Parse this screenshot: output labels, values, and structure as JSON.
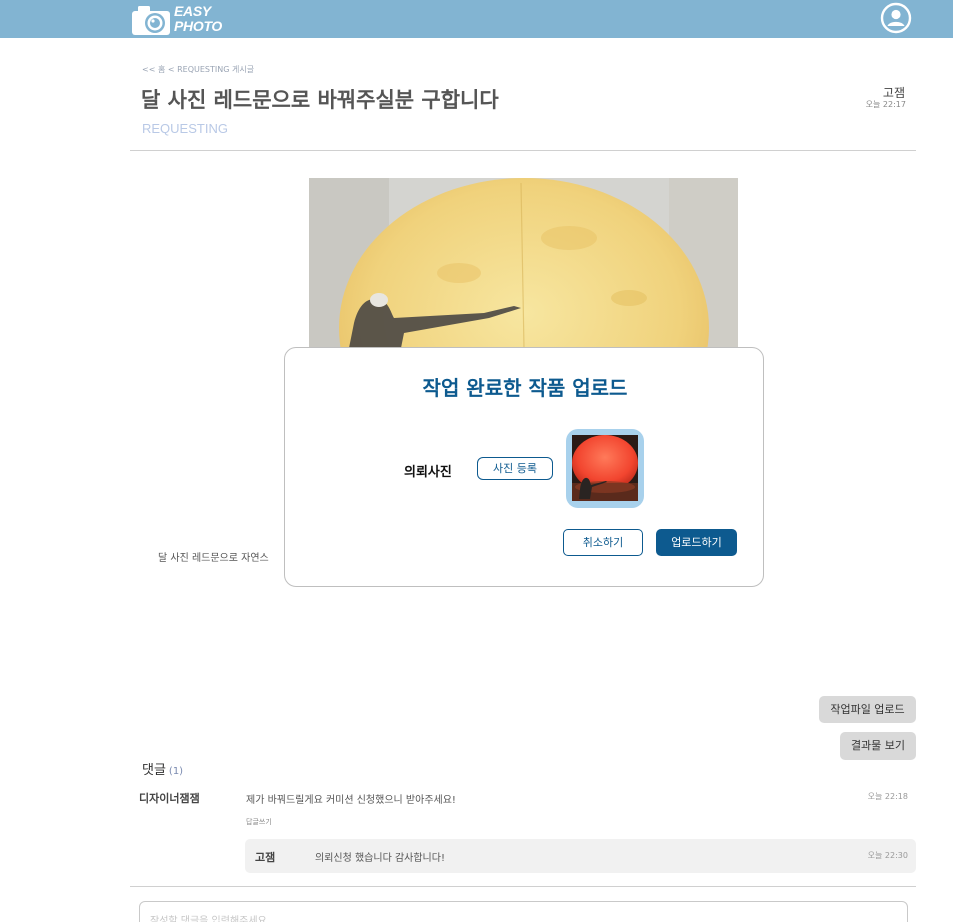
{
  "header": {
    "logo_line1": "EASY",
    "logo_line2": "PHOTO"
  },
  "post": {
    "breadcrumb": "<< 홈 < REQUESTING 게시글",
    "title": "달 사진 레드문으로 바꿔주실분 구합니다",
    "status": "REQUESTING",
    "author": "고잼",
    "time": "오늘 22:17",
    "body": "달 사진 레드문으로 자연스"
  },
  "actions": {
    "upload_work_file": "작업파일 업로드",
    "view_result": "결과물 보기"
  },
  "comments": {
    "heading": "댓글",
    "count": "(1)",
    "items": [
      {
        "author": "디자이너잼잼",
        "text": "제가 바꿔드릴게요 커미션 신청했으니 받아주세요!",
        "time": "오늘 22:18",
        "reply_label": "답글쓰기",
        "replies": [
          {
            "author": "고잼",
            "text": "의뢰신청 했습니다 감사합니다!",
            "time": "오늘 22:30"
          }
        ]
      }
    ],
    "input_placeholder": "작성할 댓글을 입력해주세요..."
  },
  "modal": {
    "title": "작업 완료한 작품 업로드",
    "field_label": "의뢰사진",
    "register_button": "사진 등록",
    "cancel_button": "취소하기",
    "upload_button": "업로드하기"
  },
  "colors": {
    "header_bg": "#82b4d2",
    "accent": "#0d5a8f",
    "status": "#b9c9e6",
    "thumb_bg": "#a8d1ec"
  },
  "icons": {
    "logo": "camera-icon",
    "profile": "user-circle-icon"
  }
}
